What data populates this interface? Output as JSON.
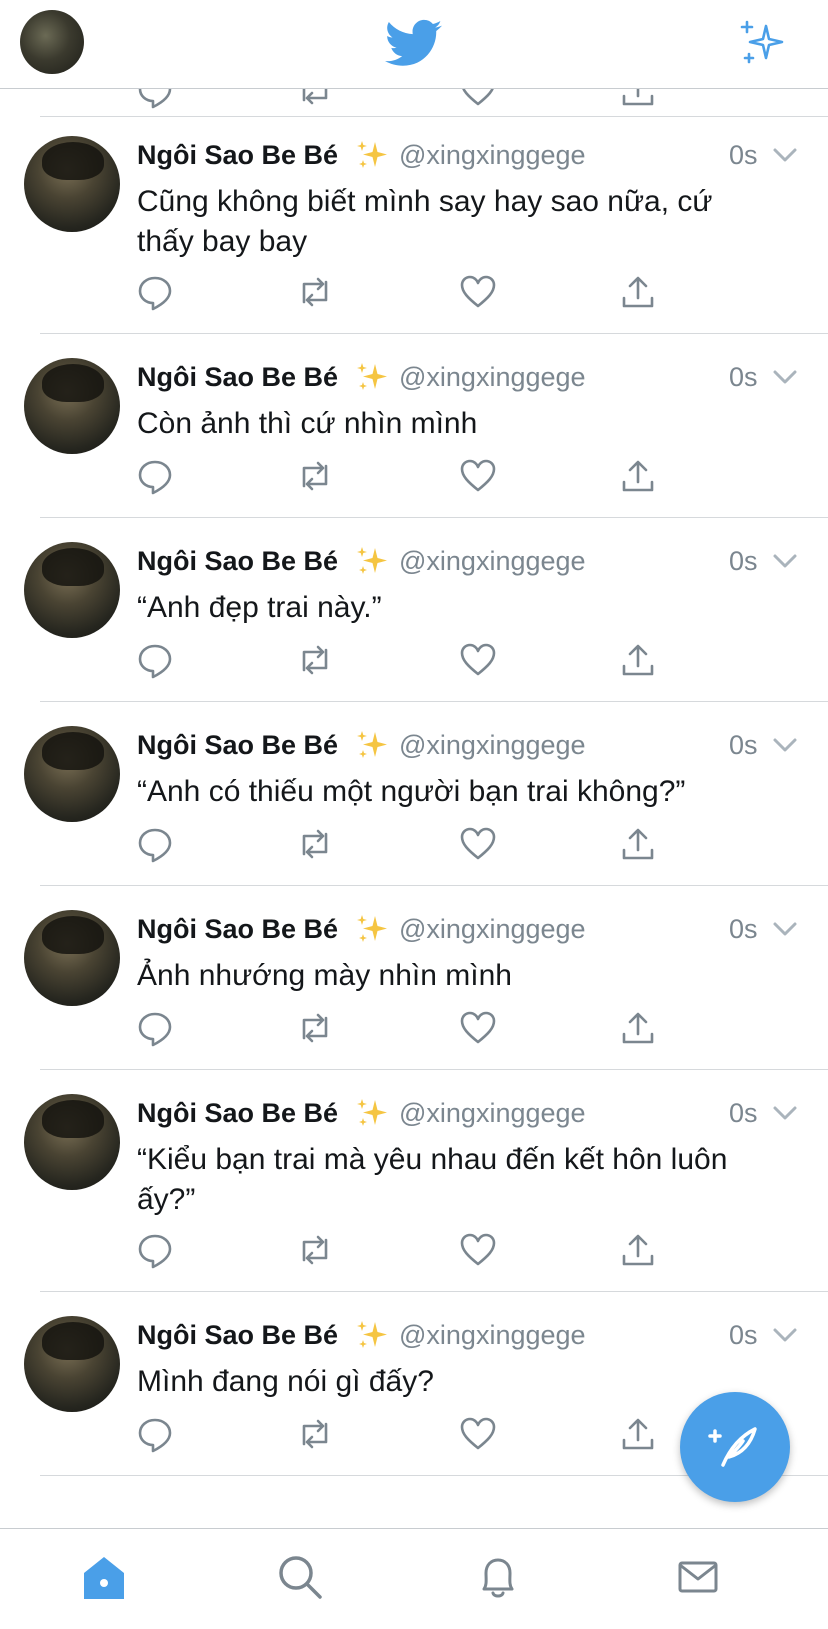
{
  "colors": {
    "accent": "#4a9fe8",
    "text": "#14171a",
    "muted": "#7b868f",
    "divider": "#d6d9dc"
  },
  "header": {
    "avatar_icon": "user-avatar",
    "logo_icon": "twitter-bird-icon",
    "sparkle_icon": "sparkle-icon"
  },
  "tweets": [
    {
      "name": "Ngôi Sao Be Bé",
      "emoji": "✨",
      "handle": "@xingxinggege",
      "time": "0s",
      "text": "Cũng không biết mình say hay sao nữa, cứ thấy bay bay"
    },
    {
      "name": "Ngôi Sao Be Bé",
      "emoji": "✨",
      "handle": "@xingxinggege",
      "time": "0s",
      "text": "Còn ảnh thì cứ nhìn mình"
    },
    {
      "name": "Ngôi Sao Be Bé",
      "emoji": "✨",
      "handle": "@xingxinggege",
      "time": "0s",
      "text": "“Anh đẹp trai này.”"
    },
    {
      "name": "Ngôi Sao Be Bé",
      "emoji": "✨",
      "handle": "@xingxinggege",
      "time": "0s",
      "text": "“Anh có thiếu một người bạn trai không?”"
    },
    {
      "name": "Ngôi Sao Be Bé",
      "emoji": "✨",
      "handle": "@xingxinggege",
      "time": "0s",
      "text": "Ảnh nhướng mày nhìn mình"
    },
    {
      "name": "Ngôi Sao Be Bé",
      "emoji": "✨",
      "handle": "@xingxinggege",
      "time": "0s",
      "text": "“Kiểu bạn trai mà yêu nhau đến kết hôn luôn ấy?”"
    },
    {
      "name": "Ngôi Sao Be Bé",
      "emoji": "✨",
      "handle": "@xingxinggege",
      "time": "0s",
      "text": "Mình đang nói gì đấy?"
    }
  ],
  "tab_bar": {
    "items": [
      "home-icon",
      "search-icon",
      "bell-icon",
      "mail-icon"
    ]
  }
}
